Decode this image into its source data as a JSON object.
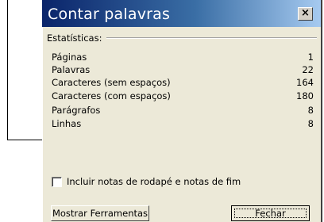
{
  "window": {
    "title": "Contar palavras",
    "close_glyph": "×"
  },
  "stats": {
    "group_label": "Estatísticas:",
    "rows": [
      {
        "label": "Páginas",
        "value": "1"
      },
      {
        "label": "Palavras",
        "value": "22"
      },
      {
        "label": "Caracteres (sem espaços)",
        "value": "164"
      },
      {
        "label": "Caracteres (com espaços)",
        "value": "180"
      },
      {
        "label": "Parágrafos",
        "value": "8"
      },
      {
        "label": "Linhas",
        "value": "8"
      }
    ]
  },
  "options": {
    "include_footnotes": {
      "label": "Incluir notas de rodapé e notas de fim",
      "checked": false
    }
  },
  "buttons": {
    "show_toolbar": "Mostrar Ferramentas",
    "close": "Fechar"
  },
  "colors": {
    "titlebar_start": "#0a246a",
    "titlebar_end": "#a6caf0",
    "dialog_bg": "#ece9d8"
  }
}
